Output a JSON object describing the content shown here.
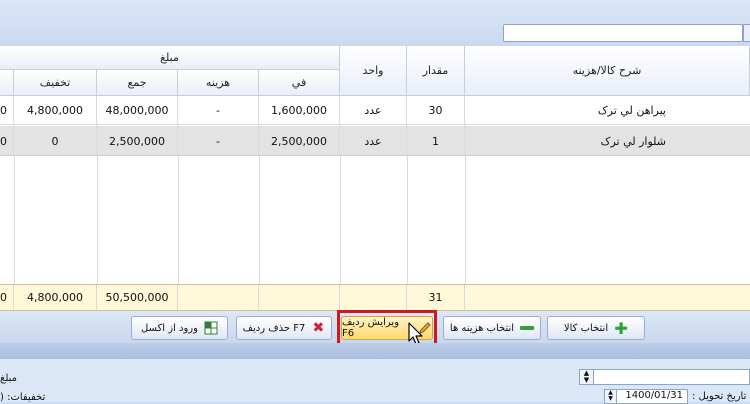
{
  "grid": {
    "headers": {
      "description": "شرح کالا/هزینه",
      "quantity": "مقدار",
      "unit": "واحد",
      "amount_group": "مبلغ",
      "unit_price": "في",
      "cost": "هزینه",
      "total": "جمع",
      "discount": "تخفیف"
    },
    "rows": [
      {
        "description": "پیراهن لي ترک",
        "quantity": "30",
        "unit": "عدد",
        "unit_price": "1,600,000",
        "cost": "-",
        "total": "48,000,000",
        "discount": "4,800,000",
        "edge": "0"
      },
      {
        "description": "شلوار لي ترک",
        "quantity": "1",
        "unit": "عدد",
        "unit_price": "2,500,000",
        "cost": "-",
        "total": "2,500,000",
        "discount": "0",
        "edge": "0"
      }
    ],
    "footer": {
      "quantity": "31",
      "total": "50,500,000",
      "discount": "4,800,000",
      "edge": "0"
    }
  },
  "buttons": {
    "select_item": "انتخاب کالا",
    "select_cost": "انتخاب هزینه ها",
    "edit_row": "ویرایش ردیف F6",
    "delete_row": "حذف ردیف F7",
    "import_excel": "ورود از اکسل"
  },
  "bottom": {
    "date_label": "تاریخ تحویل :",
    "date_value": "1400/01/31",
    "left_label_1": "مبلغ",
    "left_label_2": "تخفیفات: ("
  },
  "icons": {
    "add": "plus-icon",
    "minus": "minus-icon",
    "edit": "pencil-icon",
    "delete": "x-icon",
    "excel": "excel-icon",
    "cursor": "mouse-pointer-icon"
  }
}
